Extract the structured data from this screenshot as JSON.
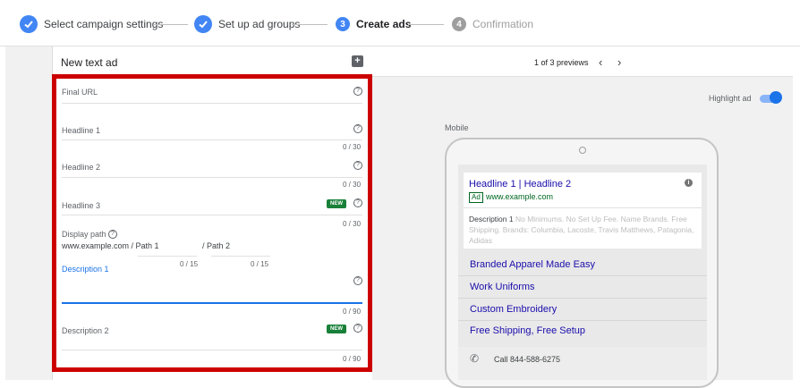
{
  "stepper": {
    "steps": [
      {
        "num": "",
        "label": "Select campaign settings",
        "state": "done"
      },
      {
        "num": "",
        "label": "Set up ad groups",
        "state": "done"
      },
      {
        "num": "3",
        "label": "Create ads",
        "state": "active"
      },
      {
        "num": "4",
        "label": "Confirmation",
        "state": "todo"
      }
    ]
  },
  "editor": {
    "title": "New text ad",
    "fields": {
      "final_url": {
        "label": "Final URL"
      },
      "headline1": {
        "label": "Headline 1",
        "counter": "0 / 30"
      },
      "headline2": {
        "label": "Headline 2",
        "counter": "0 / 30"
      },
      "headline3": {
        "label": "Headline 3",
        "badge": "NEW",
        "counter": "0 / 30"
      },
      "display_path": {
        "label": "Display path",
        "prefix": "www.example.com / Path 1",
        "path2": "/ Path 2",
        "counter1": "0 / 15",
        "counter2": "0 / 15"
      },
      "description1": {
        "label": "Description 1",
        "counter": "0 / 90"
      },
      "description2": {
        "label": "Description 2",
        "badge": "NEW",
        "counter": "0 / 90"
      }
    }
  },
  "preview": {
    "count_text": "1 of 3 previews",
    "highlight_label": "Highlight ad",
    "highlight_on": true,
    "device_label": "Mobile",
    "ad": {
      "headline": "Headline 1 | Headline 2",
      "badge": "Ad",
      "url": "www.example.com",
      "desc_lead": "Description 1",
      "desc_rest": "No Minimums. No Set Up Fee. Name Brands. Free Shipping. Brands: Columbia, Lacoste, Travis Matthews, Patagonia, Adidas"
    },
    "sitelinks": [
      "Branded Apparel Made Easy",
      "Work Uniforms",
      "Custom Embroidery",
      "Free Shipping, Free Setup"
    ],
    "call_text": "Call 844-588-6275"
  },
  "colors": {
    "accent": "#4285f4",
    "highlight_border": "#cc0000",
    "new_badge": "#188038",
    "link": "#1a0dab",
    "url_green": "#006621"
  }
}
